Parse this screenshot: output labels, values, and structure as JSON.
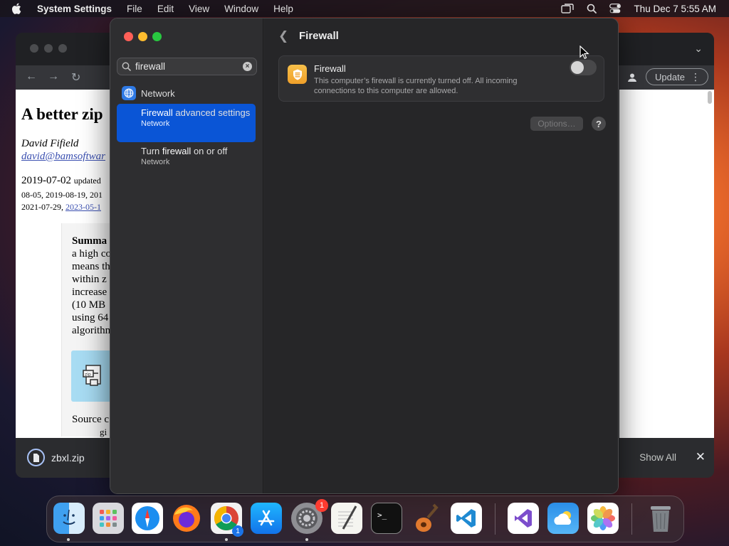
{
  "menubar": {
    "app_name": "System Settings",
    "items": [
      "File",
      "Edit",
      "View",
      "Window",
      "Help"
    ],
    "clock": "Thu Dec 7  5:55 AM"
  },
  "browser": {
    "update_label": "Update",
    "page": {
      "heading": "A better zip",
      "author": "David Fifield",
      "email": "david@bamsoftwar",
      "date_main": "2019-07-02",
      "date_updated": "updated",
      "date_line2": "08-05, 2019-08-19, 201",
      "date_line3_plain": "2021-07-29, ",
      "date_line3_link": "2023-05-1",
      "summary_bold": "Summa",
      "summary_lines": "a high co\nmeans th\nwithin z\nincrease\n(10 MB\nusing 64\nalgorithm",
      "source": "Source c",
      "source2": "gi"
    },
    "download": {
      "filename": "zbxl.zip",
      "show_all": "Show All"
    }
  },
  "settings": {
    "search": {
      "value": "firewall",
      "placeholder": "Search"
    },
    "section_label": "Network",
    "results": [
      {
        "pre": "",
        "highlight": "Firewall",
        "post": " advanced settings",
        "subtitle": "Network",
        "selected": true
      },
      {
        "pre": "Turn ",
        "highlight": "firewall",
        "post": " on or off",
        "subtitle": "Network",
        "selected": false
      }
    ],
    "page_title": "Firewall",
    "firewall": {
      "title": "Firewall",
      "description": "This computer’s firewall is currently turned off. All incoming connections to this computer are allowed.",
      "enabled": false
    },
    "options_label": "Options…",
    "help_label": "?"
  },
  "dock": {
    "apps": [
      "finder-icon",
      "launchpad-icon",
      "safari-icon",
      "firefox-icon",
      "chrome-icon",
      "app-store-icon",
      "system-settings-icon",
      "textedit-icon",
      "terminal-icon",
      "garageband-icon",
      "vscode-icon",
      "visual-studio-icon",
      "weather-icon",
      "photos-icon",
      "trash-icon"
    ],
    "settings_badge": "1",
    "chrome_badge": "1"
  },
  "colors": {
    "accent": "#0a55d6",
    "close": "#ff5f57",
    "minimize": "#febc2e",
    "zoom": "#28c840",
    "firewall_icon": "#f2a93b"
  }
}
